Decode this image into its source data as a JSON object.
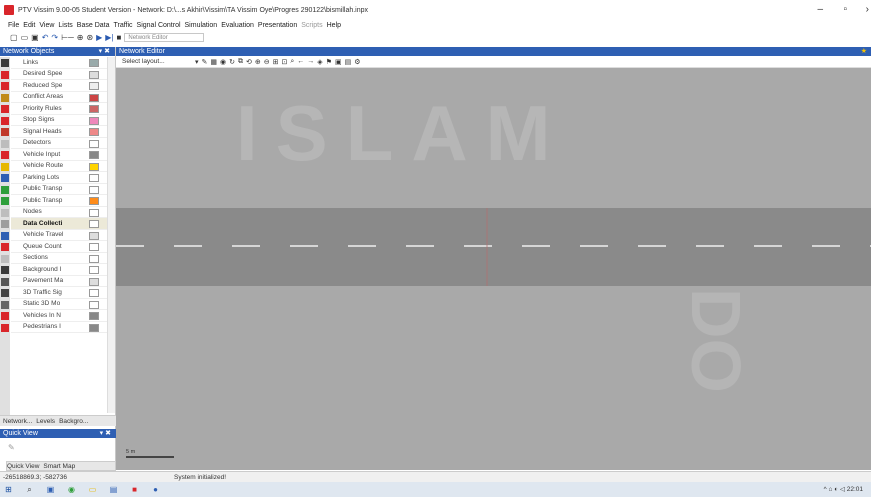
{
  "window": {
    "title": "PTV Vissim 9.00-05 Student Version - Network: D:\\...s Akhir\\Vissim\\TA Vissim Oye\\Progres 290122\\bismillah.inpx",
    "min": "–",
    "restore": "▫",
    "close": "›"
  },
  "menu": [
    "File",
    "Edit",
    "View",
    "Lists",
    "Base Data",
    "Traffic",
    "Signal Control",
    "Simulation",
    "Evaluation",
    "Presentation",
    "Scripts",
    "Help"
  ],
  "toolbar": {
    "combo": "Network Editor"
  },
  "left_panel": {
    "title": "Network Objects",
    "pin": "▾ ✖",
    "items": [
      {
        "label": "Links",
        "icon_color": "#3a3a3a"
      },
      {
        "label": "Desired Spee",
        "icon_color": "#d9262b"
      },
      {
        "label": "Reduced Spe",
        "icon_color": "#d9262b"
      },
      {
        "label": "Conflict Areas",
        "icon_color": "#c08a1a"
      },
      {
        "label": "Priority Rules",
        "icon_color": "#d9262b"
      },
      {
        "label": "Stop Signs",
        "icon_color": "#d9262b"
      },
      {
        "label": "Signal Heads",
        "icon_color": "#c0392b"
      },
      {
        "label": "Detectors",
        "icon_color": "#bdbdbd"
      },
      {
        "label": "Vehicle Input",
        "icon_color": "#d9262b"
      },
      {
        "label": "Vehicle Route",
        "icon_color": "#e6b800"
      },
      {
        "label": "Parking Lots",
        "icon_color": "#2e5fb3"
      },
      {
        "label": "Public Transp",
        "icon_color": "#2e9e3a"
      },
      {
        "label": "Public Transp",
        "icon_color": "#2e9e3a"
      },
      {
        "label": "Nodes",
        "icon_color": "#bdbdbd"
      },
      {
        "label": "Data Collecti",
        "icon_color": "#9e9e9e",
        "selected": true
      },
      {
        "label": "Vehicle Travel",
        "icon_color": "#2e5fb3"
      },
      {
        "label": "Queue Count",
        "icon_color": "#d9262b"
      },
      {
        "label": "Sections",
        "icon_color": "#bdbdbd"
      },
      {
        "label": "Background I",
        "icon_color": "#3a3a3a"
      },
      {
        "label": "Pavement Ma",
        "icon_color": "#555555"
      },
      {
        "label": "3D Traffic Sig",
        "icon_color": "#444444"
      },
      {
        "label": "Static 3D Mo",
        "icon_color": "#666666"
      },
      {
        "label": "Vehicles In N",
        "icon_color": "#d9262b"
      },
      {
        "label": "Pedestrians I",
        "icon_color": "#d9262b"
      }
    ],
    "swatches": [
      "#9aa",
      "#ddd",
      "#eee",
      "#c44",
      "#c66",
      "#e8b",
      "#e88",
      "#fff",
      "#888",
      "#ffd400",
      "#fff",
      "#fff",
      "#ff8c1a",
      "#fff",
      "#fff",
      "#ddd",
      "#fff",
      "#fff",
      "#fff",
      "#ddd",
      "#fff",
      "#fff",
      "#888",
      "#888"
    ],
    "tabs": [
      "Network...",
      "Levels",
      "Backgro..."
    ]
  },
  "quick_view": {
    "title": "Quick View",
    "pin": "▾ ✖",
    "tabs": [
      "Quick View",
      "Smart Map"
    ]
  },
  "editor": {
    "title": "Network Editor",
    "select_layout": "Select layout...",
    "scale_label": "5 m"
  },
  "status": {
    "coords": "-26518869.3; -582736",
    "message": "System initialized!"
  },
  "taskbar": {
    "tray": "^ ⌂ ◐ ◁ 22:01"
  }
}
